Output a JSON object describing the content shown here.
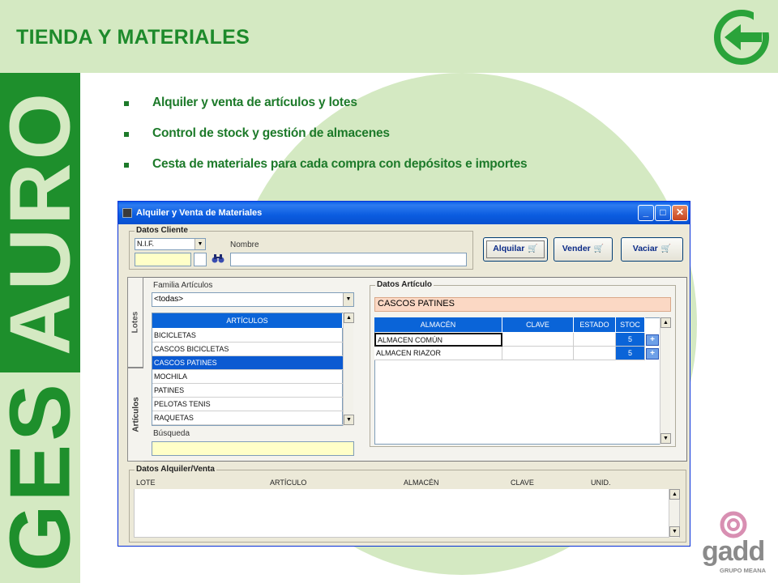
{
  "header": {
    "title": "TIENDA Y MATERIALES",
    "logo_icon": "g-arrow-icon"
  },
  "sidebar": {
    "brand_top": "AURO",
    "brand_bottom": "GES"
  },
  "bullets": [
    "Alquiler y venta de artículos y lotes",
    "Control de stock y gestión de almacenes",
    "Cesta de materiales para cada compra con depósitos e importes"
  ],
  "window": {
    "title": "Alquiler y Venta de Materiales",
    "controls": {
      "minimize": "_",
      "maximize": "□",
      "close": "✕"
    },
    "datos_cliente": {
      "legend": "Datos Cliente",
      "id_type": "N.I.F.",
      "id_value": "",
      "nombre_label": "Nombre",
      "nombre_value": ""
    },
    "buttons": {
      "alquilar": "Alquilar",
      "vender": "Vender",
      "vaciar": "Vaciar"
    },
    "tabs": {
      "lotes": "Lotes",
      "articulos": "Artículos"
    },
    "familia": {
      "label": "Familia Artículos",
      "selected": "<todas>"
    },
    "articulos_header": "ARTÍCULOS",
    "articulos": [
      "BICICLETAS",
      "CASCOS BICICLETAS",
      "CASCOS PATINES",
      "MOCHILA",
      "PATINES",
      "PELOTAS TENIS",
      "RAQUETAS"
    ],
    "selected_articulo_index": 2,
    "busqueda": {
      "label": "Búsqueda",
      "value": ""
    },
    "datos_articulo": {
      "legend": "Datos Artículo",
      "name": "CASCOS PATINES",
      "columns": [
        "ALMACÉN",
        "CLAVE",
        "ESTADO",
        "STOC"
      ],
      "rows": [
        {
          "almacen": "ALMACEN COMÚN",
          "clave": "",
          "estado": "",
          "stock": "5"
        },
        {
          "almacen": "ALMACEN RIAZOR",
          "clave": "",
          "estado": "",
          "stock": "5"
        }
      ]
    },
    "datos_alquiler": {
      "legend": "Datos Alquiler/Venta",
      "columns": [
        "LOTE",
        "ARTÍCULO",
        "ALMACÉN",
        "CLAVE",
        "UNID."
      ]
    }
  },
  "footer_logo": {
    "name": "gadd",
    "subtitle": "GRUPO MEANA"
  },
  "colors": {
    "green_dark": "#1e8f2c",
    "green_light": "#d4e9c2",
    "xp_blue": "#0a5fe8",
    "selection": "#0b5ad2"
  }
}
